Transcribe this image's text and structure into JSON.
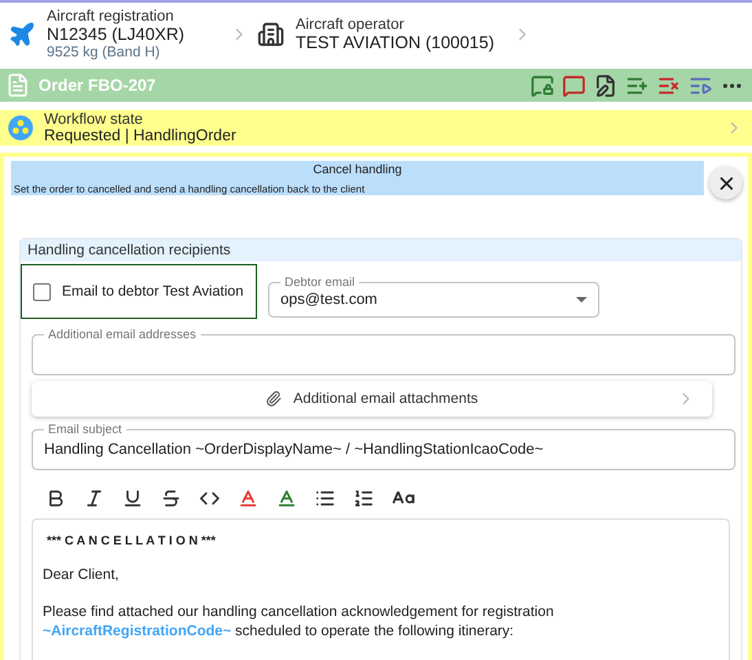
{
  "aircraft": {
    "label": "Aircraft registration",
    "value": "N12345 (LJ40XR)",
    "detail": "9525 kg (Band H)"
  },
  "operator": {
    "label": "Aircraft operator",
    "value": "TEST AVIATION (100015)"
  },
  "order": {
    "title": "Order FBO-207"
  },
  "workflow": {
    "label": "Workflow state",
    "value": "Requested | HandlingOrder"
  },
  "dialog": {
    "title": "Cancel handling",
    "description": "Set the order to cancelled and send a handling cancellation back to the client"
  },
  "recipients": {
    "title": "Handling cancellation recipients",
    "debtor_checkbox": {
      "label": "Email to debtor Test Aviation",
      "checked": false
    },
    "debtor_email": {
      "label": "Debtor email",
      "value": "ops@test.com"
    },
    "additional_emails": {
      "label": "Additional email addresses"
    }
  },
  "attachments": {
    "label": "Additional email attachments"
  },
  "subject": {
    "label": "Email subject",
    "value": "Handling Cancellation ~OrderDisplayName~ / ~HandlingStationIcaoCode~"
  },
  "body": {
    "heading": "*** C A N C E L L A T I O N ***",
    "paragraphs": [
      "Dear Client,",
      "Please find attached our handling cancellation acknowledgement for registration **~AircraftRegistrationCode~** scheduled to operate the following itinerary:"
    ]
  }
}
